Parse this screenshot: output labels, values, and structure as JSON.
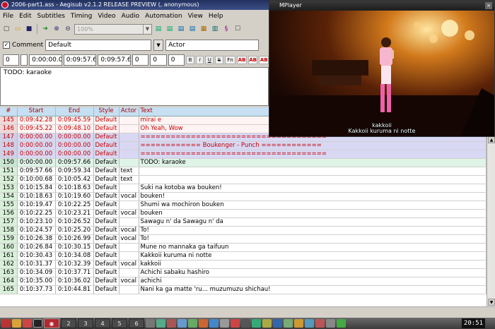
{
  "aegisub": {
    "title": "2006-part1.ass - Aegisub v2.1.2 RELEASE PREVIEW (, anonymous)",
    "menu": [
      "File",
      "Edit",
      "Subtitles",
      "Timing",
      "Video",
      "Audio",
      "Automation",
      "View",
      "Help"
    ],
    "zoom_value": "100%",
    "comment_label": "Comment",
    "style_value": "Default",
    "actor_placeholder": "Actor",
    "layer": "0",
    "start_time": "0:00:00.00",
    "end_time": "0:09:57.66",
    "duration": "0:09:57.66",
    "margin_l": "0",
    "margin_r": "0",
    "margin_v": "0",
    "fmt_buttons": [
      "B",
      "I",
      "U",
      "S",
      "Fn",
      "AB",
      "AB",
      "AB"
    ],
    "edit_text": "TODO: karaoke"
  },
  "grid": {
    "headers": {
      "num": "#",
      "start": "Start",
      "end": "End",
      "style": "Style",
      "actor": "Actor",
      "text": "Text"
    },
    "rows": [
      {
        "kind": "prev",
        "num": "145",
        "start": "0:09:42.28",
        "end": "0:09:45.59",
        "style": "Default",
        "actor": "",
        "text": "mirai e"
      },
      {
        "kind": "prev",
        "num": "146",
        "start": "0:09:45.22",
        "end": "0:09:48.10",
        "style": "Default",
        "actor": "",
        "text": "Oh Yeah, Wow"
      },
      {
        "kind": "comment",
        "num": "147",
        "start": "0:00:00.00",
        "end": "0:00:00.00",
        "style": "Default",
        "actor": "",
        "text": "====================================="
      },
      {
        "kind": "comment",
        "num": "148",
        "start": "0:00:00.00",
        "end": "0:00:00.00",
        "style": "Default",
        "actor": "",
        "text": "============ Boukenger - Punch ============"
      },
      {
        "kind": "comment",
        "num": "149",
        "start": "0:00:00.00",
        "end": "0:00:00.00",
        "style": "Default",
        "actor": "",
        "text": "====================================="
      },
      {
        "kind": "sel",
        "num": "150",
        "start": "0:00:00.00",
        "end": "0:09:57.66",
        "style": "Default",
        "actor": "",
        "text": "TODO: karaoke"
      },
      {
        "kind": "plain",
        "num": "151",
        "start": "0:09:57.66",
        "end": "0:09:59.34",
        "style": "Default",
        "actor": "text",
        "text": ""
      },
      {
        "kind": "plain",
        "num": "152",
        "start": "0:10:00.68",
        "end": "0:10:05.42",
        "style": "Default",
        "actor": "text",
        "text": ""
      },
      {
        "kind": "plain",
        "num": "153",
        "start": "0:10:15.84",
        "end": "0:10:18.63",
        "style": "Default",
        "actor": "",
        "text": "Suki na kotoba wa bouken!"
      },
      {
        "kind": "plain",
        "num": "154",
        "start": "0:10:18.63",
        "end": "0:10:19.60",
        "style": "Default",
        "actor": "vocal",
        "text": "bouken!"
      },
      {
        "kind": "plain",
        "num": "155",
        "start": "0:10:19.47",
        "end": "0:10:22.25",
        "style": "Default",
        "actor": "",
        "text": "Shumi wa mochiron bouken"
      },
      {
        "kind": "plain",
        "num": "156",
        "start": "0:10:22.25",
        "end": "0:10:23.21",
        "style": "Default",
        "actor": "vocal",
        "text": "bouken"
      },
      {
        "kind": "plain",
        "num": "157",
        "start": "0:10:23.10",
        "end": "0:10:26.52",
        "style": "Default",
        "actor": "",
        "text": "Sawagu n' da Sawagu n' da"
      },
      {
        "kind": "plain",
        "num": "158",
        "start": "0:10:24.57",
        "end": "0:10:25.20",
        "style": "Default",
        "actor": "vocal",
        "text": "To!"
      },
      {
        "kind": "plain",
        "num": "159",
        "start": "0:10:26.38",
        "end": "0:10:26.99",
        "style": "Default",
        "actor": "vocal",
        "text": "To!"
      },
      {
        "kind": "plain",
        "num": "160",
        "start": "0:10:26.84",
        "end": "0:10:30.15",
        "style": "Default",
        "actor": "",
        "text": "Mune no mannaka ga taifuun"
      },
      {
        "kind": "plain",
        "num": "161",
        "start": "0:10:30.43",
        "end": "0:10:34.08",
        "style": "Default",
        "actor": "",
        "text": "Kakkoii kuruma ni notte"
      },
      {
        "kind": "plain",
        "num": "162",
        "start": "0:10:31.37",
        "end": "0:10:32.39",
        "style": "Default",
        "actor": "vocal",
        "text": "kakkoii"
      },
      {
        "kind": "plain",
        "num": "163",
        "start": "0:10:34.09",
        "end": "0:10:37.71",
        "style": "Default",
        "actor": "",
        "text": "Achichi sabaku hashiro"
      },
      {
        "kind": "plain",
        "num": "164",
        "start": "0:10:35.00",
        "end": "0:10:36.02",
        "style": "Default",
        "actor": "vocal",
        "text": "achichi"
      },
      {
        "kind": "plain",
        "num": "165",
        "start": "0:10:37.73",
        "end": "0:10:44.81",
        "style": "Default",
        "actor": "",
        "text": "Nani ka ga matte 'ru... muzumuzu shichau!"
      }
    ]
  },
  "mplayer": {
    "title": "MPlayer",
    "sub_line1": "kakkoii",
    "sub_line2": "Kakkoii kuruma ni notte"
  },
  "taskbar": {
    "workspaces": [
      "2",
      "3",
      "4",
      "5",
      "6"
    ],
    "clock": "20:51"
  }
}
